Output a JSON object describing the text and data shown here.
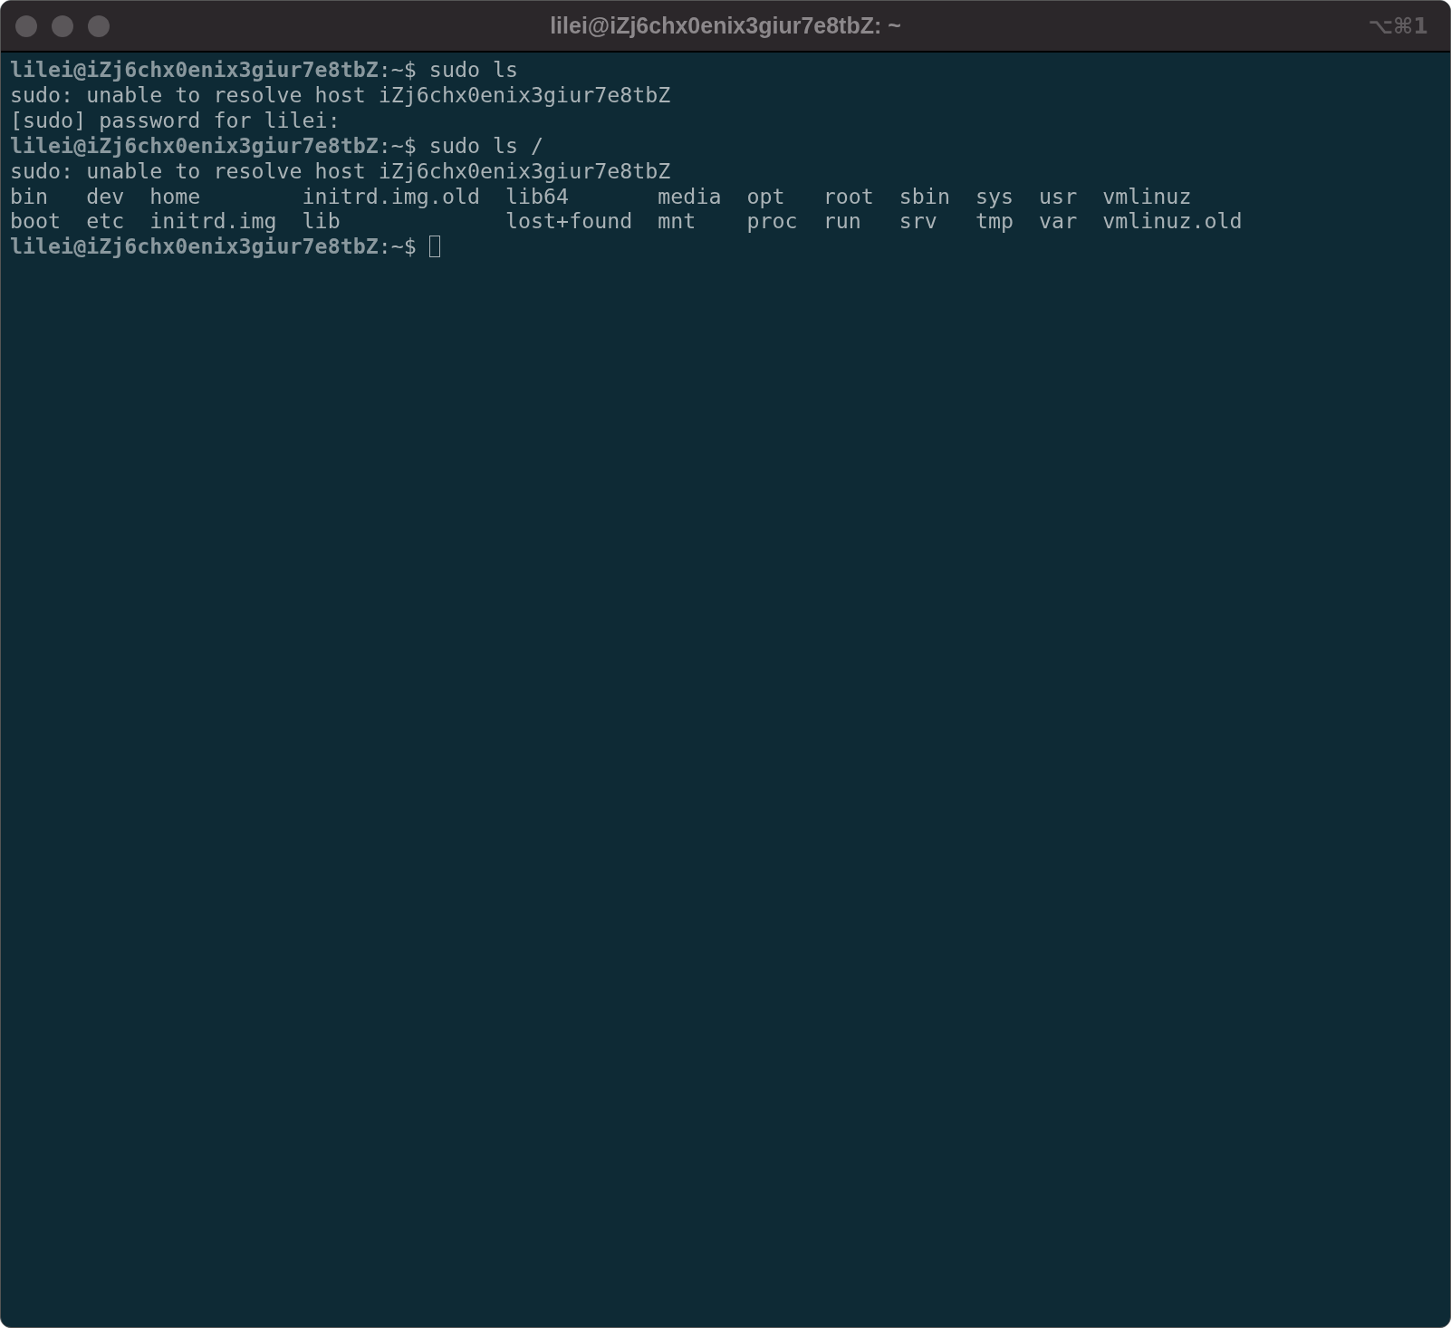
{
  "window": {
    "title": "lilei@iZj6chx0enix3giur7e8tbZ: ~",
    "shortcut": "⌥⌘1"
  },
  "terminal": {
    "lines": [
      {
        "text": "**lilei@iZj6chx0enix3giur7e8tbZ**:~$ sudo ls",
        "cursor": false
      },
      {
        "text": "sudo: unable to resolve host iZj6chx0enix3giur7e8tbZ",
        "cursor": false
      },
      {
        "text": "[sudo] password for lilei:",
        "cursor": false
      },
      {
        "text": "**lilei@iZj6chx0enix3giur7e8tbZ**:~$ sudo ls /",
        "cursor": false
      },
      {
        "text": "sudo: unable to resolve host iZj6chx0enix3giur7e8tbZ",
        "cursor": false
      },
      {
        "text": "bin   dev  home        initrd.img.old  lib64       media  opt   root  sbin  sys  usr  vmlinuz",
        "cursor": false
      },
      {
        "text": "boot  etc  initrd.img  lib             lost+found  mnt    proc  run   srv   tmp  var  vmlinuz.old",
        "cursor": false
      },
      {
        "text": "**lilei@iZj6chx0enix3giur7e8tbZ**:~$",
        "cursor": true
      }
    ]
  }
}
